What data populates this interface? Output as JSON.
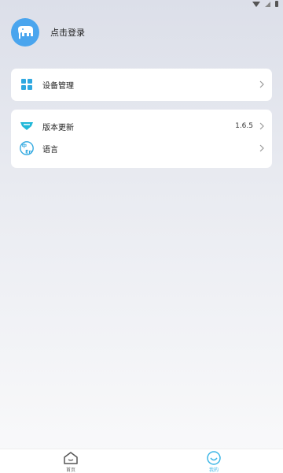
{
  "status_bar": {
    "icons": [
      "wifi-icon",
      "signal-icon",
      "battery-icon"
    ]
  },
  "profile": {
    "login_label": "点击登录",
    "avatar_icon": "elephant-icon",
    "avatar_color": "#4aa5ee"
  },
  "devices_card": {
    "items": [
      {
        "label": "设备管理",
        "icon": "grid-icon"
      }
    ]
  },
  "settings_card": {
    "items": [
      {
        "label": "版本更新",
        "value": "1.6.5",
        "icon": "gem-icon"
      },
      {
        "label": "语言",
        "icon": "language-icon"
      }
    ]
  },
  "tab_bar": {
    "tabs": [
      {
        "label": "首页",
        "icon": "home-icon",
        "active": false
      },
      {
        "label": "我的",
        "icon": "smile-icon",
        "active": true
      }
    ],
    "accent": "#3cb6e6"
  }
}
